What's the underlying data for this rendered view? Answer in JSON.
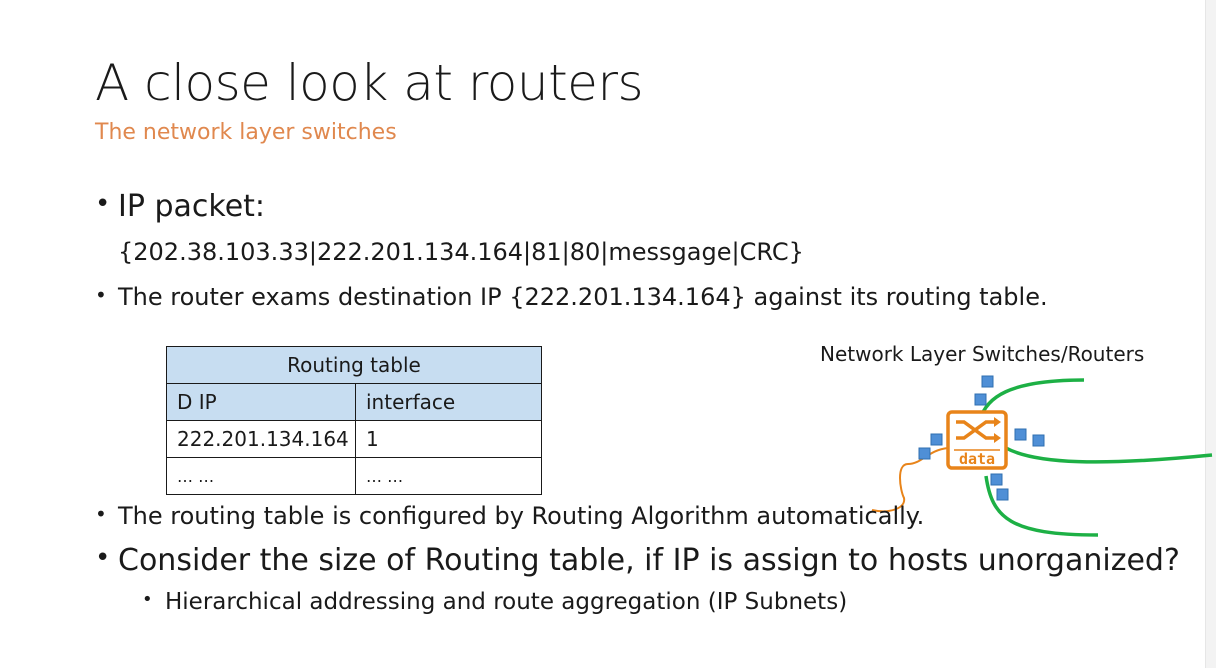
{
  "slide": {
    "title": "A close look at routers",
    "subtitle": "The network layer switches"
  },
  "bullets": {
    "b1": "IP packet:",
    "packet": "{202.38.103.33|222.201.134.164|81|80|messgage|CRC}",
    "b2": "The router exams destination IP {222.201.134.164} against its routing table.",
    "b3": "The routing table is configured by Routing Algorithm automatically.",
    "b4": "Consider the size of Routing table, if IP is assign to hosts unorganized?",
    "b5": "Hierarchical addressing and route aggregation (IP Subnets)"
  },
  "routing_table": {
    "caption": "Routing table",
    "headers": [
      "D IP",
      "interface"
    ],
    "rows": [
      [
        "222.201.134.164",
        "1"
      ],
      [
        "… …",
        "… …"
      ]
    ]
  },
  "diagram": {
    "label": "Network Layer Switches/Routers",
    "router_text": "data",
    "router_icon": "router-switch-icon",
    "colors": {
      "router": "#e8841a",
      "link_green": "#1db045",
      "link_orange": "#e8841a",
      "packet_blue": "#4f8fd6"
    }
  },
  "bullet_symbol": "•"
}
